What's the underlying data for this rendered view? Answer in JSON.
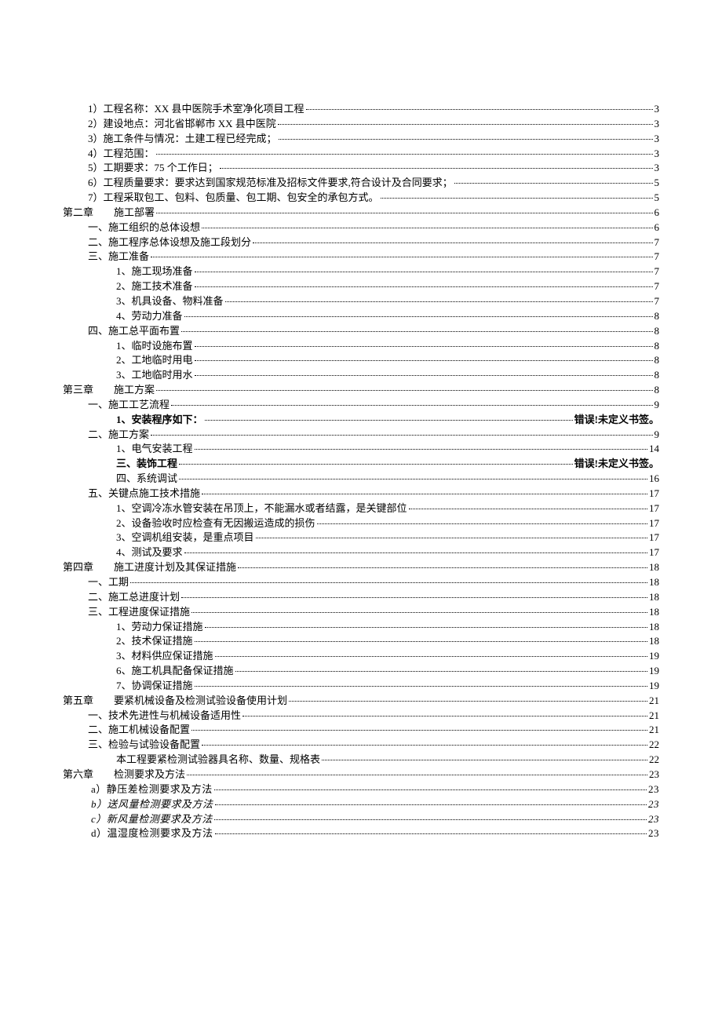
{
  "toc": [
    {
      "indent": "lv1",
      "text": "1）工程名称：XX 县中医院手术室净化项目工程",
      "page": "3",
      "cls": ""
    },
    {
      "indent": "lv1",
      "text": "2）建设地点：河北省邯郸市 XX 县中医院",
      "page": "3",
      "cls": ""
    },
    {
      "indent": "lv1",
      "text": "3）施工条件与情况：土建工程已经完成；",
      "page": "3",
      "cls": ""
    },
    {
      "indent": "lv1",
      "text": "4）工程范围：",
      "page": "3",
      "cls": ""
    },
    {
      "indent": "lv1",
      "text": "5）工期要求：75 个工作日；",
      "page": "3",
      "cls": ""
    },
    {
      "indent": "lv1",
      "text": "6）工程质量要求：要求达到国家规范标准及招标文件要求,符合设计及合同要求；",
      "page": "5",
      "cls": ""
    },
    {
      "indent": "lv1",
      "text": "7）工程采取包工、包料、包质量、包工期、包安全的承包方式。",
      "page": "5",
      "cls": ""
    },
    {
      "indent": "lv0",
      "text": "第二章　　施工部署",
      "page": "6",
      "cls": ""
    },
    {
      "indent": "lv1",
      "text": "一、施工组织的总体设想",
      "page": "6",
      "cls": ""
    },
    {
      "indent": "lv1",
      "text": "二、施工程序总体设想及施工段划分",
      "page": "7",
      "cls": ""
    },
    {
      "indent": "lv1",
      "text": "三、施工准备",
      "page": "7",
      "cls": ""
    },
    {
      "indent": "lv2",
      "text": "1、施工现场准备",
      "page": "7",
      "cls": ""
    },
    {
      "indent": "lv2",
      "text": "2、施工技术准备",
      "page": "7",
      "cls": ""
    },
    {
      "indent": "lv2",
      "text": "3、机具设备、物料准备",
      "page": "7",
      "cls": ""
    },
    {
      "indent": "lv2",
      "text": "4、劳动力准备",
      "page": "8",
      "cls": ""
    },
    {
      "indent": "lv1",
      "text": "四、施工总平面布置",
      "page": "8",
      "cls": ""
    },
    {
      "indent": "lv2",
      "text": "1、临时设施布置",
      "page": "8",
      "cls": ""
    },
    {
      "indent": "lv2",
      "text": "2、工地临时用电",
      "page": "8",
      "cls": ""
    },
    {
      "indent": "lv2",
      "text": "3、工地临时用水",
      "page": "8",
      "cls": ""
    },
    {
      "indent": "lv0",
      "text": "第三章　　施工方案",
      "page": "8",
      "cls": ""
    },
    {
      "indent": "lv1",
      "text": "一、施工工艺流程",
      "page": "9",
      "cls": ""
    },
    {
      "indent": "lv2",
      "text": "1、安装程序如下：",
      "page": "错误!未定义书签。",
      "cls": "err"
    },
    {
      "indent": "lv1",
      "text": "二、施工方案",
      "page": "9",
      "cls": ""
    },
    {
      "indent": "lv2",
      "text": "1、电气安装工程",
      "page": "14",
      "cls": ""
    },
    {
      "indent": "lv2",
      "text": "三、装饰工程",
      "page": "错误!未定义书签。",
      "cls": "err"
    },
    {
      "indent": "lv2",
      "text": "四、系统调试",
      "page": "16",
      "cls": ""
    },
    {
      "indent": "lv1",
      "text": "五、关键点施工技术措施",
      "page": "17",
      "cls": ""
    },
    {
      "indent": "lv2",
      "text": "1、空调冷冻水管安装在吊顶上，不能漏水或者结露，是关键部位",
      "page": "17",
      "cls": ""
    },
    {
      "indent": "lv2",
      "text": "2、设备验收时应检查有无因搬运造成的损伤",
      "page": "17",
      "cls": ""
    },
    {
      "indent": "lv2",
      "text": "3、空调机组安装，是重点项目",
      "page": "17",
      "cls": ""
    },
    {
      "indent": "lv2",
      "text": "4、测试及要求",
      "page": "17",
      "cls": ""
    },
    {
      "indent": "lv0",
      "text": "第四章　　施工进度计划及其保证措施",
      "page": "18",
      "cls": ""
    },
    {
      "indent": "lv1",
      "text": "一、工期",
      "page": "18",
      "cls": ""
    },
    {
      "indent": "lv1",
      "text": "二、施工总进度计划",
      "page": "18",
      "cls": ""
    },
    {
      "indent": "lv1",
      "text": "三、工程进度保证措施",
      "page": "18",
      "cls": ""
    },
    {
      "indent": "lv2",
      "text": "1、劳动力保证措施",
      "page": "18",
      "cls": ""
    },
    {
      "indent": "lv2",
      "text": "2、技术保证措施",
      "page": "18",
      "cls": ""
    },
    {
      "indent": "lv2",
      "text": "3、材料供应保证措施",
      "page": "19",
      "cls": ""
    },
    {
      "indent": "lv2",
      "text": "6、施工机具配备保证措施",
      "page": "19",
      "cls": ""
    },
    {
      "indent": "lv2",
      "text": "7、协调保证措施",
      "page": "19",
      "cls": ""
    },
    {
      "indent": "lv0",
      "text": "第五章　　要紧机械设备及检测试验设备使用计划",
      "page": "21",
      "cls": ""
    },
    {
      "indent": "lv1",
      "text": "一、技术先进性与机械设备适用性",
      "page": "21",
      "cls": ""
    },
    {
      "indent": "lv1",
      "text": "二、施工机械设备配置",
      "page": "21",
      "cls": ""
    },
    {
      "indent": "lv1",
      "text": "三、检验与试验设备配置",
      "page": "22",
      "cls": ""
    },
    {
      "indent": "lv2",
      "text": "本工程要紧检测试验器具名称、数量、规格表",
      "page": "22",
      "cls": ""
    },
    {
      "indent": "lv0",
      "text": "第六章　　检测要求及方法",
      "page": "23",
      "cls": ""
    },
    {
      "indent": "lv1b",
      "text": "a）静压差检测要求及方法",
      "page": "23",
      "cls": ""
    },
    {
      "indent": "lv1b",
      "text": "b）送风量检测要求及方法",
      "page": "23",
      "cls": "italic"
    },
    {
      "indent": "lv1b",
      "text": "c）新风量检测要求及方法",
      "page": "23",
      "cls": "italic"
    },
    {
      "indent": "lv1b",
      "text": "d）温湿度检测要求及方法",
      "page": "23",
      "cls": ""
    }
  ]
}
